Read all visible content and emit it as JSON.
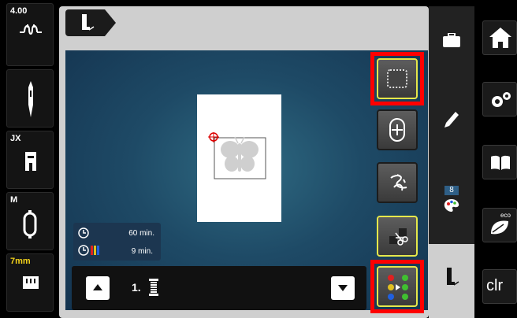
{
  "left_panel": {
    "stitch_width": "4.00",
    "foot_label": "JX",
    "hoop_label": "M",
    "stitch_length": "7mm"
  },
  "time": {
    "total": "60 min.",
    "color": "9 min."
  },
  "bottom": {
    "color_index": "1."
  },
  "right_panel": {
    "color_count": "8",
    "clr_label": "clr",
    "eco_label": "eco"
  },
  "colors": {
    "highlight": "#ff0000",
    "active_border": "#e6e84a",
    "accent_yellow": "#f3d21a"
  }
}
